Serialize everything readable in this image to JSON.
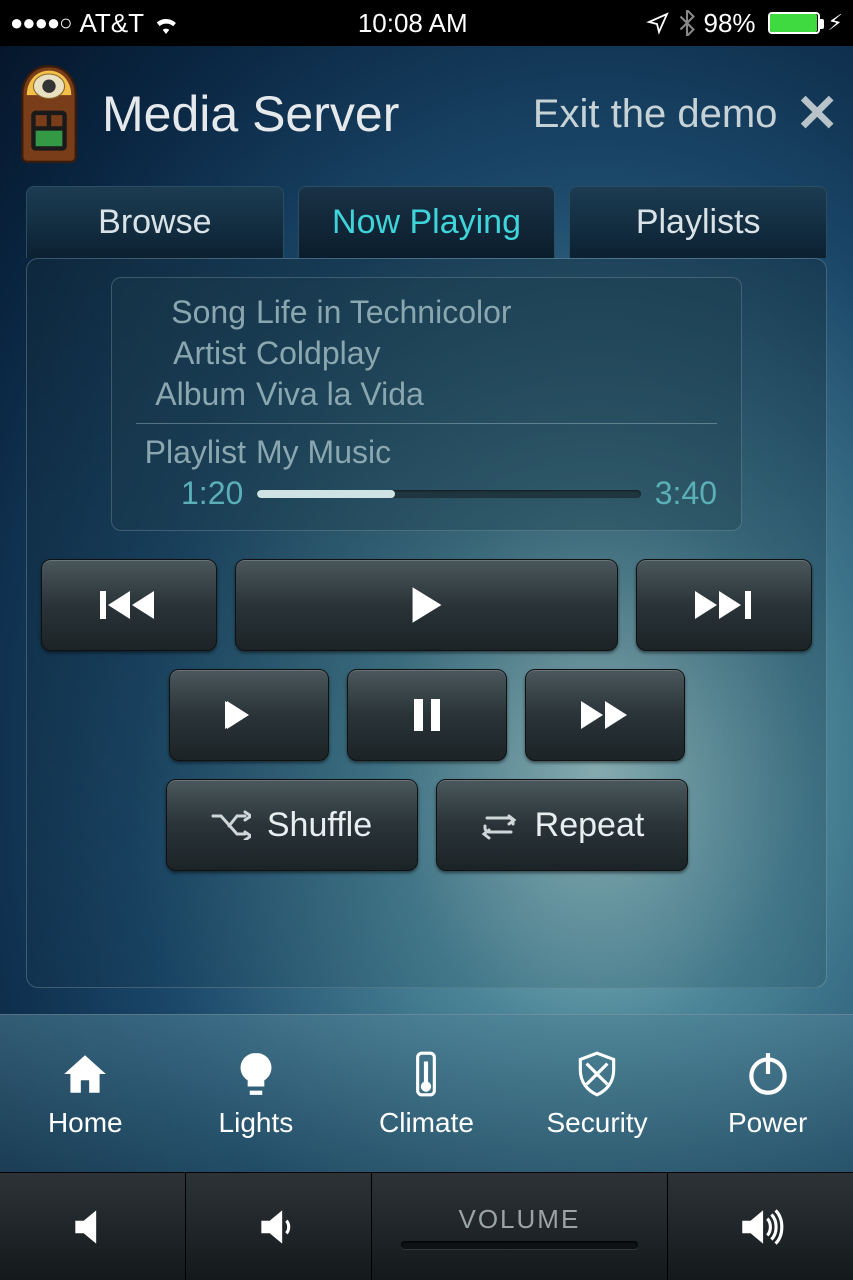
{
  "status": {
    "carrier": "AT&T",
    "time": "10:08 AM",
    "battery_pct": "98%"
  },
  "header": {
    "title": "Media Server",
    "exit_label": "Exit the demo"
  },
  "tabs": {
    "browse": "Browse",
    "now_playing": "Now Playing",
    "playlists": "Playlists"
  },
  "now_playing": {
    "song_label": "Song",
    "song": "Life in Technicolor",
    "artist_label": "Artist",
    "artist": "Coldplay",
    "album_label": "Album",
    "album": "Viva la Vida",
    "playlist_label": "Playlist",
    "playlist": "My Music",
    "elapsed": "1:20",
    "total": "3:40",
    "progress_pct": 36
  },
  "controls": {
    "shuffle": "Shuffle",
    "repeat": "Repeat"
  },
  "nav": {
    "home": "Home",
    "lights": "Lights",
    "climate": "Climate",
    "security": "Security",
    "power": "Power"
  },
  "volume": {
    "label": "VOLUME"
  }
}
